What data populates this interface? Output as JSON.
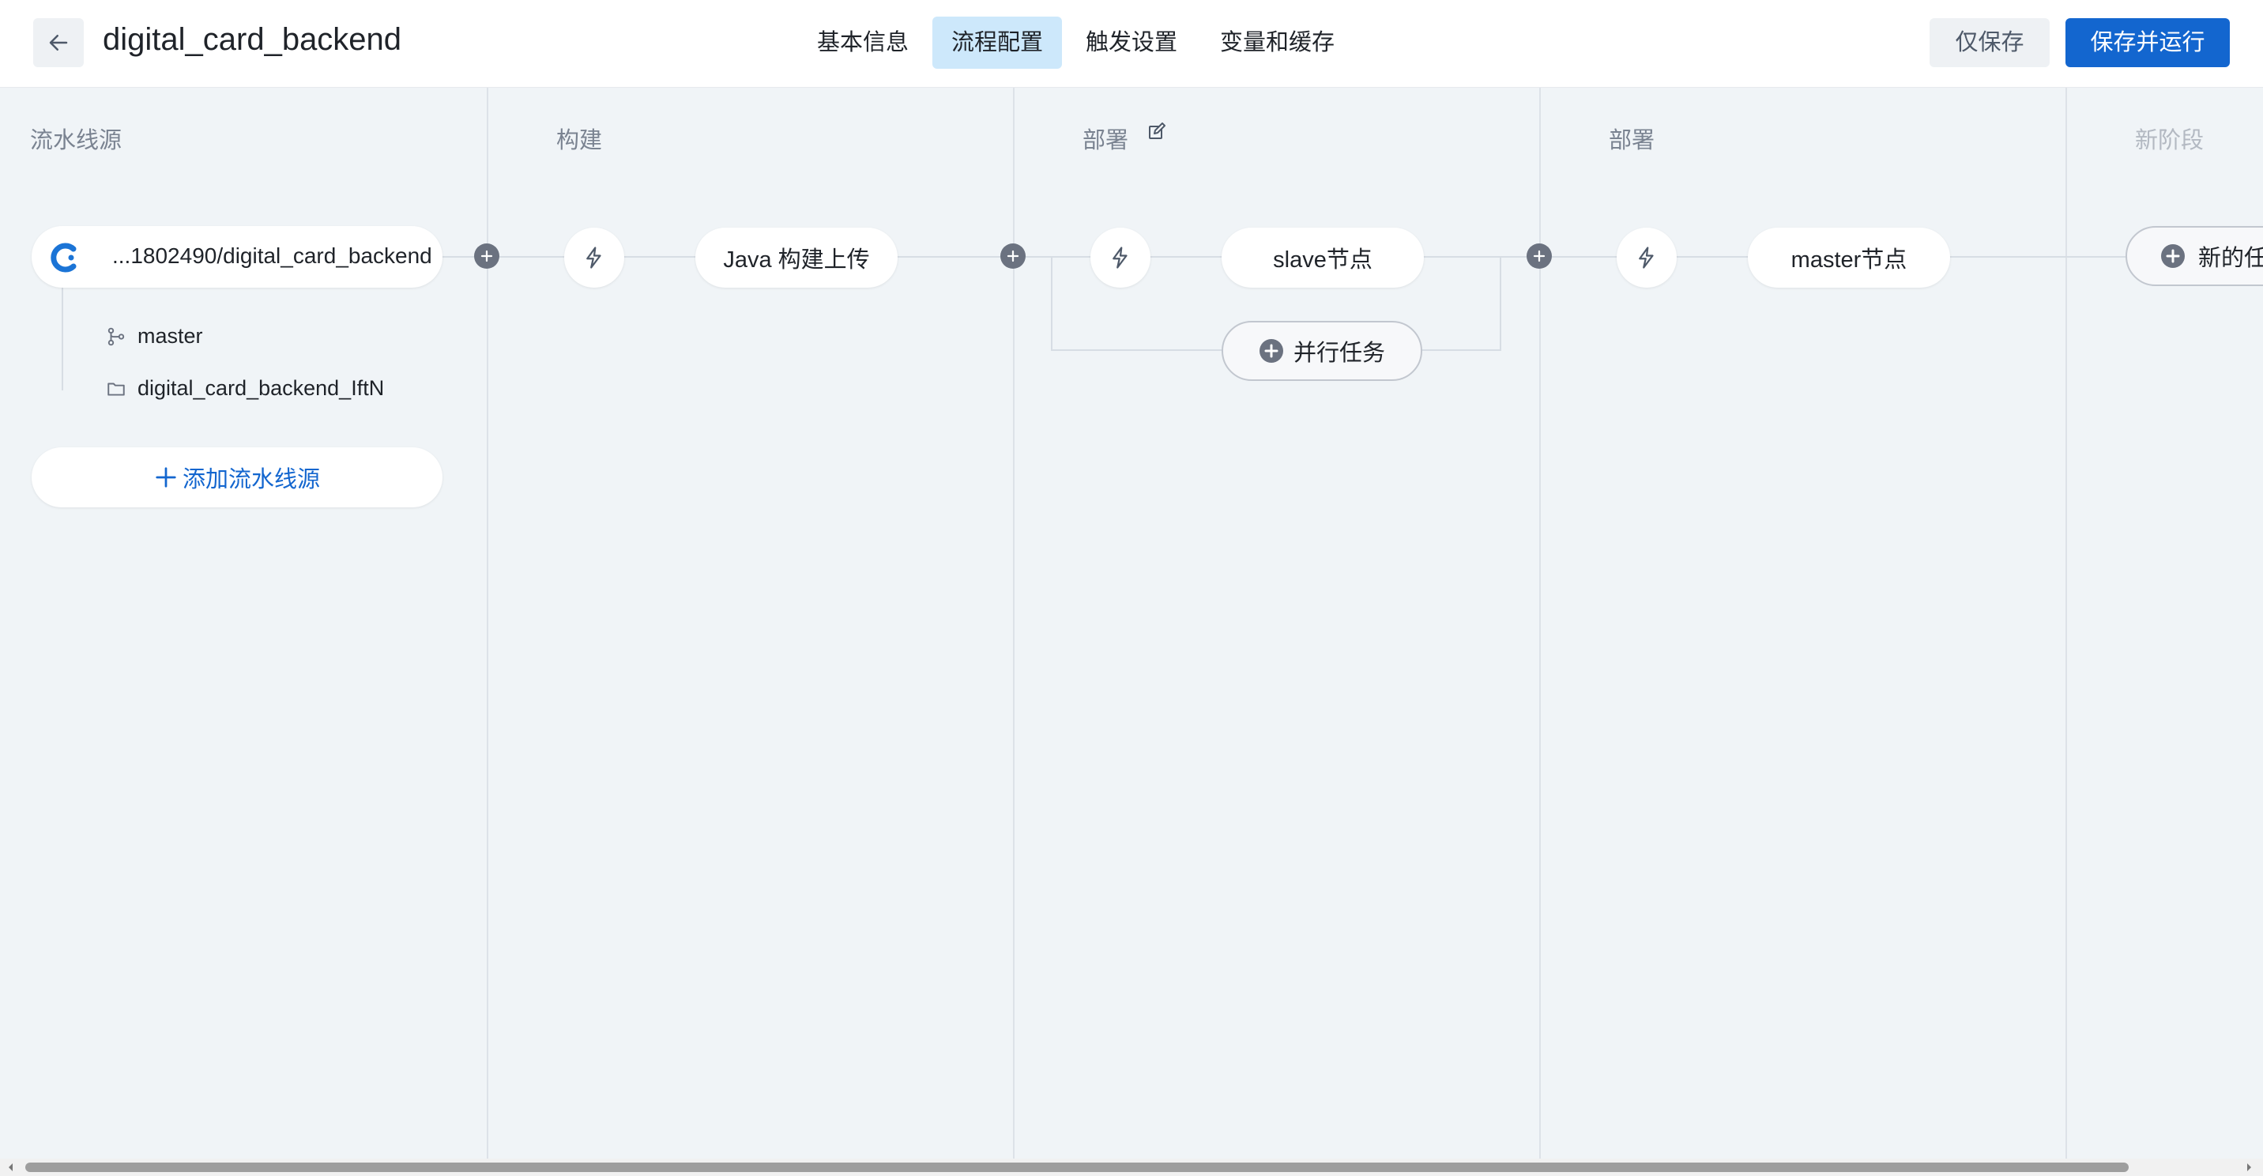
{
  "header": {
    "title": "digital_card_backend",
    "tabs": [
      {
        "label": "基本信息",
        "active": false
      },
      {
        "label": "流程配置",
        "active": true
      },
      {
        "label": "触发设置",
        "active": false
      },
      {
        "label": "变量和缓存",
        "active": false
      }
    ],
    "save_label": "仅保存",
    "save_run_label": "保存并运行"
  },
  "stages": [
    {
      "title": "流水线源"
    },
    {
      "title": "构建"
    },
    {
      "title": "部署"
    },
    {
      "title": "部署"
    },
    {
      "title": "新阶段"
    }
  ],
  "source": {
    "repo": "...1802490/digital_card_backend",
    "branch": "master",
    "folder": "digital_card_backend_IftN",
    "add_label": "添加流水线源"
  },
  "jobs": {
    "build": "Java 构建上传",
    "deploy1": "slave节点",
    "parallel": "并行任务",
    "deploy2": "master节点",
    "new_task": "新的任"
  },
  "colors": {
    "accent": "#1366cf",
    "active_tab": "#cde8fb"
  }
}
